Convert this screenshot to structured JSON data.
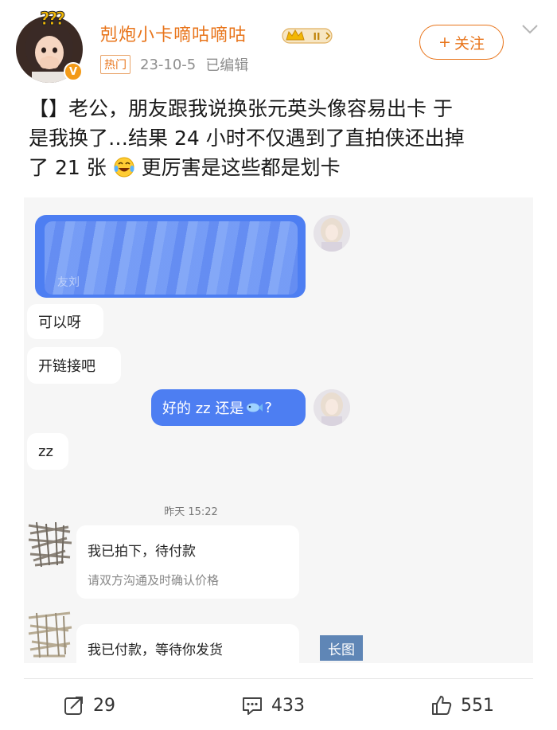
{
  "header": {
    "username": "剋炮小卡嘀咕嘀咕",
    "avatar_marks": "???",
    "verified_badge": "V",
    "level_badge_label": "II",
    "hot_tag": "热门",
    "date": "23-10-5",
    "edited": "已编辑",
    "follow_label": "关注",
    "follow_plus": "+"
  },
  "post": {
    "line1": "【】老公，朋友跟我说换张元英头像容易出卡 于",
    "line2": "是我换了…结果 24 小时不仅遇到了直拍侠还出掉",
    "line3_a": "了 21 张",
    "line3_b": "更厉害是这些都是划卡"
  },
  "chat": {
    "blurred_label": "友刘",
    "msg_1": "可以呀",
    "msg_2": "开链接吧",
    "msg_3_a": "好的 zz 还是",
    "msg_3_b": "?",
    "msg_4": "zz",
    "timestamp": "昨天 15:22",
    "card1_title": "我已拍下，待付款",
    "card1_sub": "请双方沟通及时确认价格",
    "card2_title": "我已付款，等待你发货"
  },
  "long_image_tag": "长图",
  "footer": {
    "repost_count": "29",
    "comment_count": "433",
    "like_count": "551"
  },
  "colors": {
    "brand_orange": "#e8741a",
    "chat_blue": "#4d7ef2",
    "long_tag_blue": "#5f86b6"
  },
  "icons": {
    "repost": "repost-icon",
    "comment": "comment-icon",
    "like": "thumbs-up-icon",
    "chevron": "chevron-down-icon"
  }
}
